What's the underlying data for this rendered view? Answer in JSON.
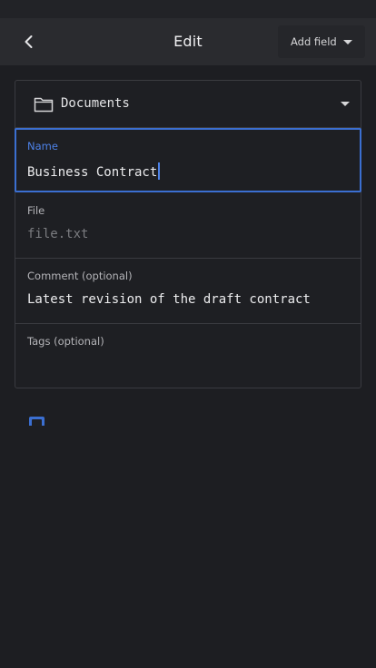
{
  "header": {
    "title": "Edit",
    "add_field_label": "Add field"
  },
  "icons": {
    "back": "chevron-left-icon",
    "folder": "folder-icon",
    "dropdown": "caret-down-icon"
  },
  "colors": {
    "accent": "#3b6fd1",
    "background": "#1d1e22"
  },
  "folder": {
    "selected": "Documents"
  },
  "fields": [
    {
      "label": "Name",
      "value": "Business Contract",
      "active": true
    },
    {
      "label": "File",
      "placeholder": "file.txt"
    },
    {
      "label": "Comment (optional)",
      "value": "Latest revision of the draft contract"
    },
    {
      "label": "Tags (optional)",
      "value": ""
    }
  ],
  "options": {
    "notification_checked": true
  }
}
